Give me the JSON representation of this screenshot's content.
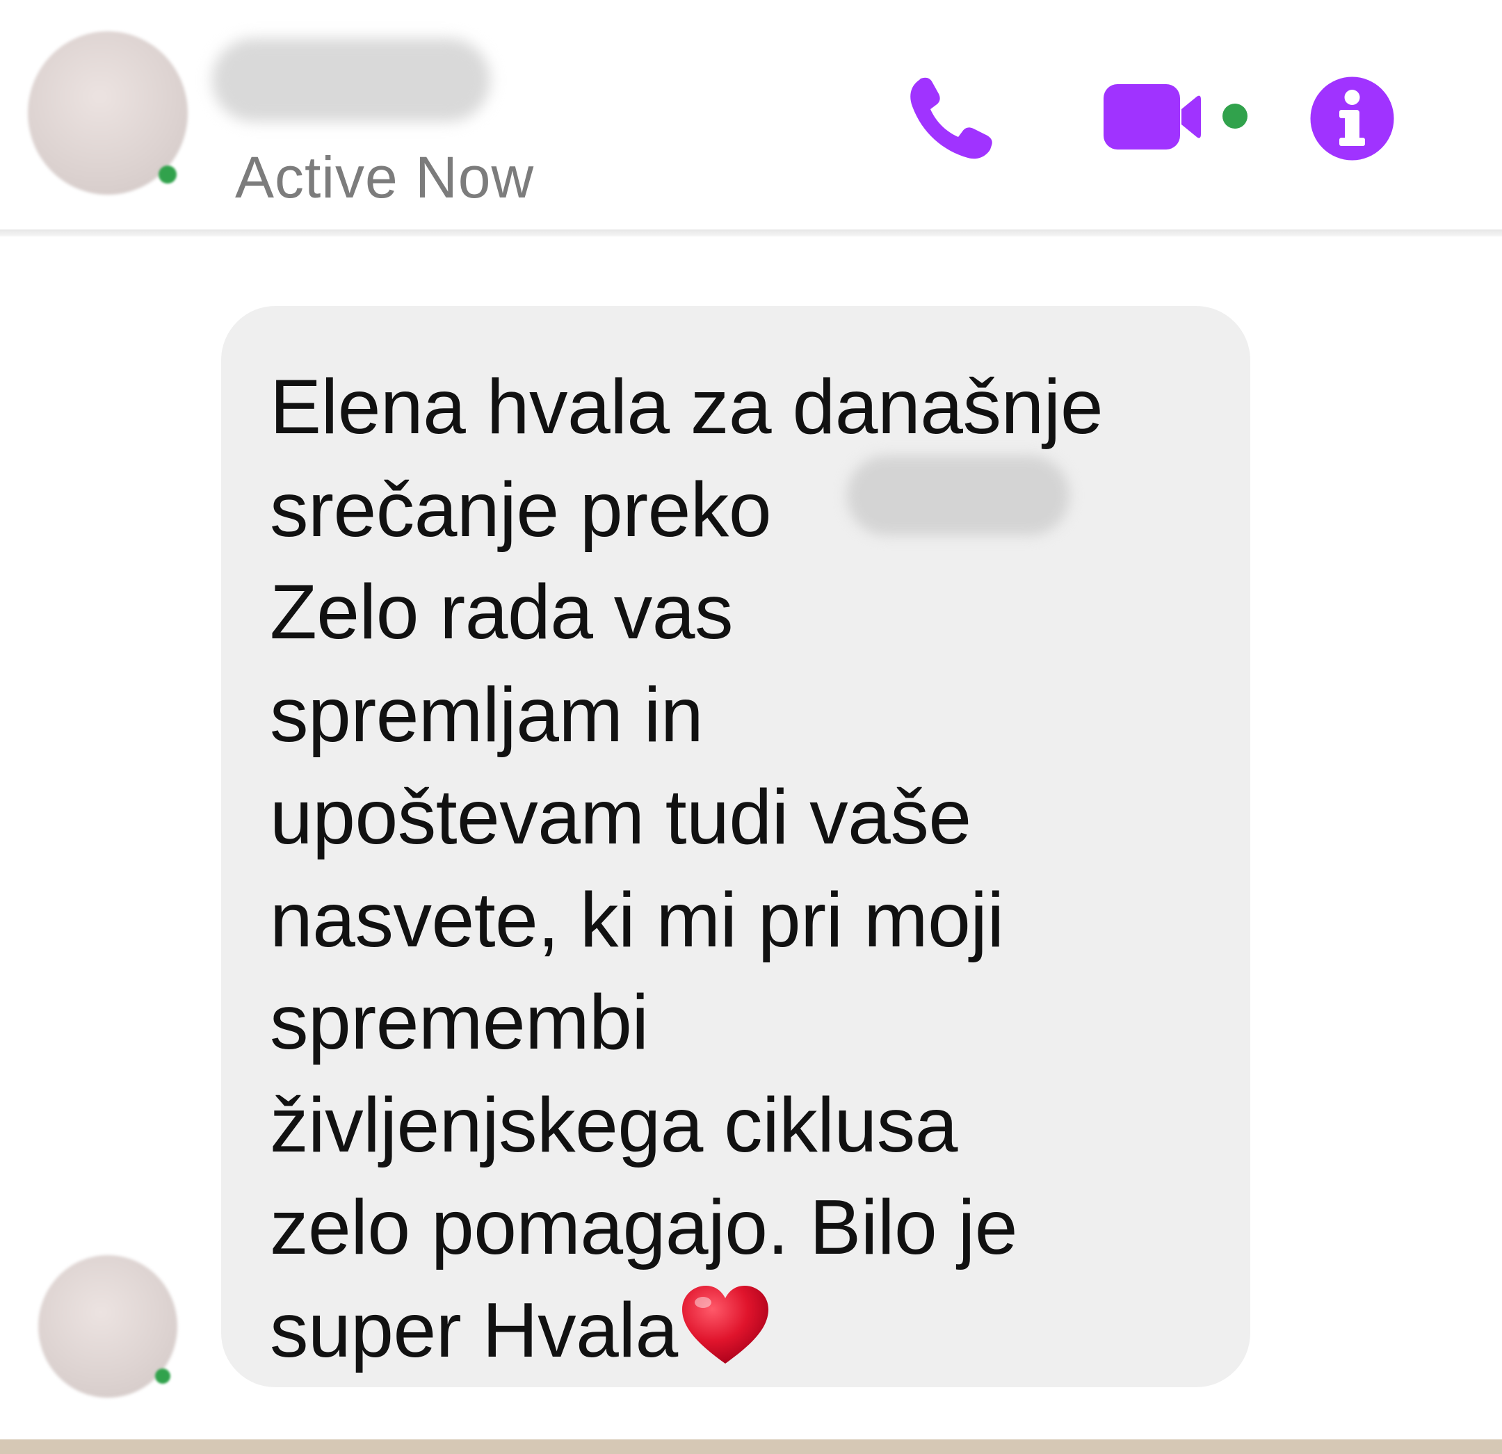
{
  "header": {
    "status": "Active Now",
    "icons": {
      "call": "phone-icon",
      "video": "video-camera-icon",
      "info": "info-icon"
    }
  },
  "message": {
    "text": "Elena hvala za današnje\nsrečanje preko\nZelo rada vas\nspremljam in\nupoštevam tudi vaše\nnasvete, ki mi pri moji\nspremembi\nživljenjskega ciklusa\nzelo pomagajo. Bilo je\nsuper Hvala",
    "emoji": "heart-emoji"
  },
  "colors": {
    "accent": "#a033ff",
    "online": "#31a24c",
    "bubble": "#efefef",
    "text": "#111111",
    "status_text": "#7c7c7c",
    "heart": "#e0142c"
  }
}
